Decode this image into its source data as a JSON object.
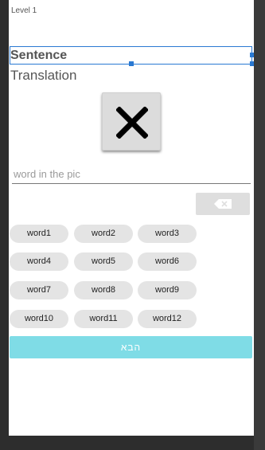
{
  "level": {
    "label": "Level 1"
  },
  "sentence": {
    "text": "Sentence"
  },
  "translation": {
    "text": "Translation"
  },
  "picture_button": {
    "icon": "close-icon"
  },
  "answer_input": {
    "placeholder": "word in the pic",
    "value": ""
  },
  "backspace_button": {
    "icon": "backspace-icon"
  },
  "word_chips": [
    {
      "label": "word1"
    },
    {
      "label": "word2"
    },
    {
      "label": "word3"
    },
    {
      "label": "word4"
    },
    {
      "label": "word5"
    },
    {
      "label": "word6"
    },
    {
      "label": "word7"
    },
    {
      "label": "word8"
    },
    {
      "label": "word9"
    },
    {
      "label": "word10"
    },
    {
      "label": "word11"
    },
    {
      "label": "word12"
    }
  ],
  "next_button": {
    "label": "הבא"
  },
  "colors": {
    "selection_outline": "#2a79d2",
    "chip_background": "#e4e4e4",
    "next_button_background": "#7fdce6",
    "backspace_background": "#dedede"
  }
}
